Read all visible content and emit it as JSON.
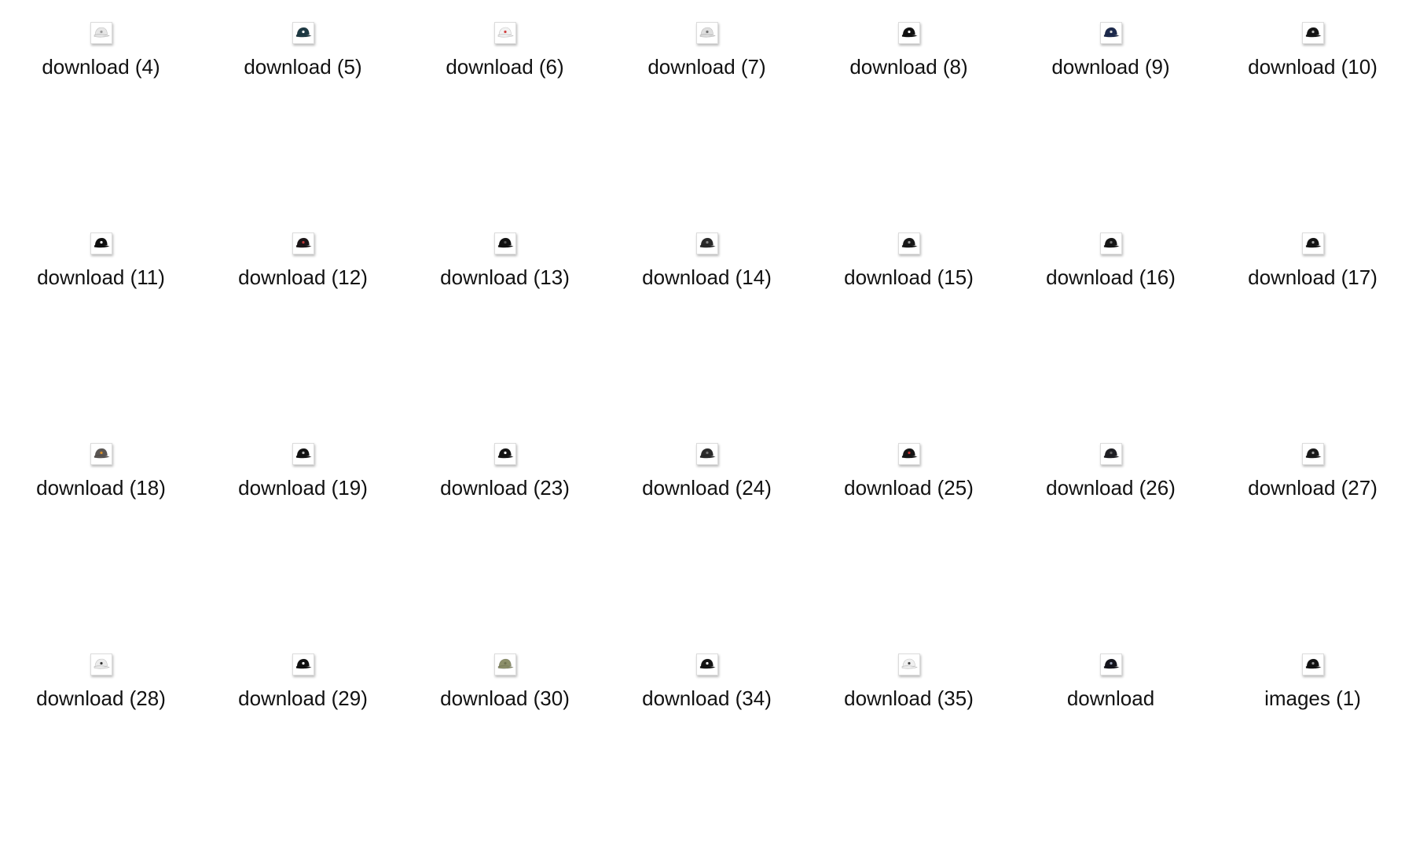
{
  "files": [
    {
      "name": "download (4)",
      "icon": "cap-white-icon",
      "color": "#e6e6e6",
      "accent": "#9a9a9a"
    },
    {
      "name": "download (5)",
      "icon": "cap-dark-teal-icon",
      "color": "#1e3a44",
      "accent": "#ffffff"
    },
    {
      "name": "download (6)",
      "icon": "cap-white-icon",
      "color": "#f2f2f2",
      "accent": "#d04040"
    },
    {
      "name": "download (7)",
      "icon": "cap-white-icon",
      "color": "#dedede",
      "accent": "#707070"
    },
    {
      "name": "download (8)",
      "icon": "cap-black-icon",
      "color": "#111111",
      "accent": "#ffffff"
    },
    {
      "name": "download (9)",
      "icon": "cap-navy-icon",
      "color": "#1d2a4d",
      "accent": "#d8d8d8"
    },
    {
      "name": "download (10)",
      "icon": "cap-black-icon",
      "color": "#151515",
      "accent": "#bbbbbb"
    },
    {
      "name": "download (11)",
      "icon": "cap-black-icon",
      "color": "#0f0f0f",
      "accent": "#ffffff"
    },
    {
      "name": "download (12)",
      "icon": "cap-black-icon",
      "color": "#1c1618",
      "accent": "#c23a3a"
    },
    {
      "name": "download (13)",
      "icon": "cap-black-icon",
      "color": "#121212",
      "accent": "#555555"
    },
    {
      "name": "download (14)",
      "icon": "cap-black-icon",
      "color": "#2a2a2a",
      "accent": "#888888"
    },
    {
      "name": "download (15)",
      "icon": "cap-black-icon",
      "color": "#181818",
      "accent": "#999999"
    },
    {
      "name": "download (16)",
      "icon": "cap-black-icon",
      "color": "#161616",
      "accent": "#777777"
    },
    {
      "name": "download (17)",
      "icon": "cap-black-icon",
      "color": "#141414",
      "accent": "#aaaaaa"
    },
    {
      "name": "download (18)",
      "icon": "cap-gray-icon",
      "color": "#5b5653",
      "accent": "#d8902a"
    },
    {
      "name": "download (19)",
      "icon": "cap-black-icon",
      "color": "#121212",
      "accent": "#bbbbbb"
    },
    {
      "name": "download (23)",
      "icon": "cap-black-icon",
      "color": "#141414",
      "accent": "#ffffff"
    },
    {
      "name": "download (24)",
      "icon": "cap-black-icon",
      "color": "#2b2b2b",
      "accent": "#777777"
    },
    {
      "name": "download (25)",
      "icon": "cap-black-icon",
      "color": "#151515",
      "accent": "#c83030"
    },
    {
      "name": "download (26)",
      "icon": "cap-black-icon",
      "color": "#1f1f24",
      "accent": "#666666"
    },
    {
      "name": "download (27)",
      "icon": "cap-black-icon",
      "color": "#1a1a1a",
      "accent": "#aaaaaa"
    },
    {
      "name": "download (28)",
      "icon": "cap-white-icon",
      "color": "#ececec",
      "accent": "#333333"
    },
    {
      "name": "download (29)",
      "icon": "cap-black-icon",
      "color": "#111111",
      "accent": "#ffffff"
    },
    {
      "name": "download (30)",
      "icon": "cap-olive-icon",
      "color": "#8c8f6a",
      "accent": "#6f7252"
    },
    {
      "name": "download (34)",
      "icon": "cap-black-icon",
      "color": "#141414",
      "accent": "#ffffff"
    },
    {
      "name": "download (35)",
      "icon": "cap-white-icon",
      "color": "#f0f0f0",
      "accent": "#444444"
    },
    {
      "name": "download",
      "icon": "cap-black-icon",
      "color": "#15151d",
      "accent": "#9aa3b8"
    },
    {
      "name": "images (1)",
      "icon": "cap-black-icon",
      "color": "#121212",
      "accent": "#999999"
    }
  ]
}
